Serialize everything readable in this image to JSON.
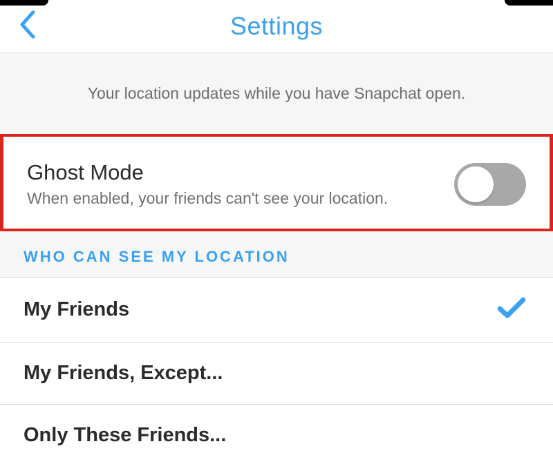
{
  "header": {
    "title": "Settings"
  },
  "info_banner": {
    "text": "Your location updates while you have Snapchat open."
  },
  "ghost_mode": {
    "title": "Ghost Mode",
    "description": "When enabled, your friends can't see your location.",
    "enabled": false
  },
  "who_can_see": {
    "header": "WHO CAN SEE MY LOCATION",
    "options": [
      {
        "label": "My Friends",
        "selected": true
      },
      {
        "label": "My Friends, Except...",
        "selected": false
      },
      {
        "label": "Only These Friends...",
        "selected": false
      }
    ]
  },
  "colors": {
    "accent": "#3aa0f2",
    "highlight_border": "#d8261e"
  }
}
